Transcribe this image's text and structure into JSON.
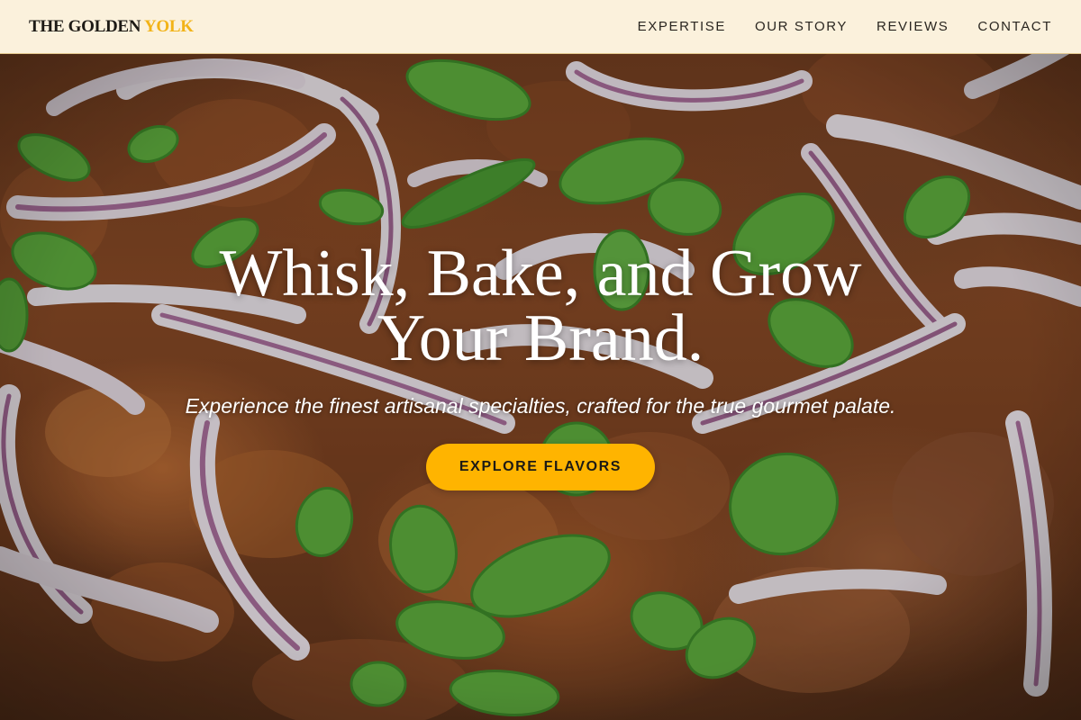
{
  "navbar": {
    "brand_main": "THE GOLDEN ",
    "brand_accent": "YOLK",
    "links": [
      {
        "label": "EXPERTISE"
      },
      {
        "label": "OUR STORY"
      },
      {
        "label": "REVIEWS"
      },
      {
        "label": "CONTACT"
      }
    ]
  },
  "hero": {
    "title_line1": "Whisk, Bake, and Grow",
    "title_line2": "Your Brand.",
    "subtitle": "Experience the finest artisanal specialties, crafted for the true gourmet palate.",
    "cta_label": "EXPLORE FLAVORS"
  },
  "colors": {
    "accent": "#ffb400",
    "brand_accent": "#f2b317",
    "navbar_bg": "#fbf1dc",
    "text_dark": "#1d1a15"
  }
}
